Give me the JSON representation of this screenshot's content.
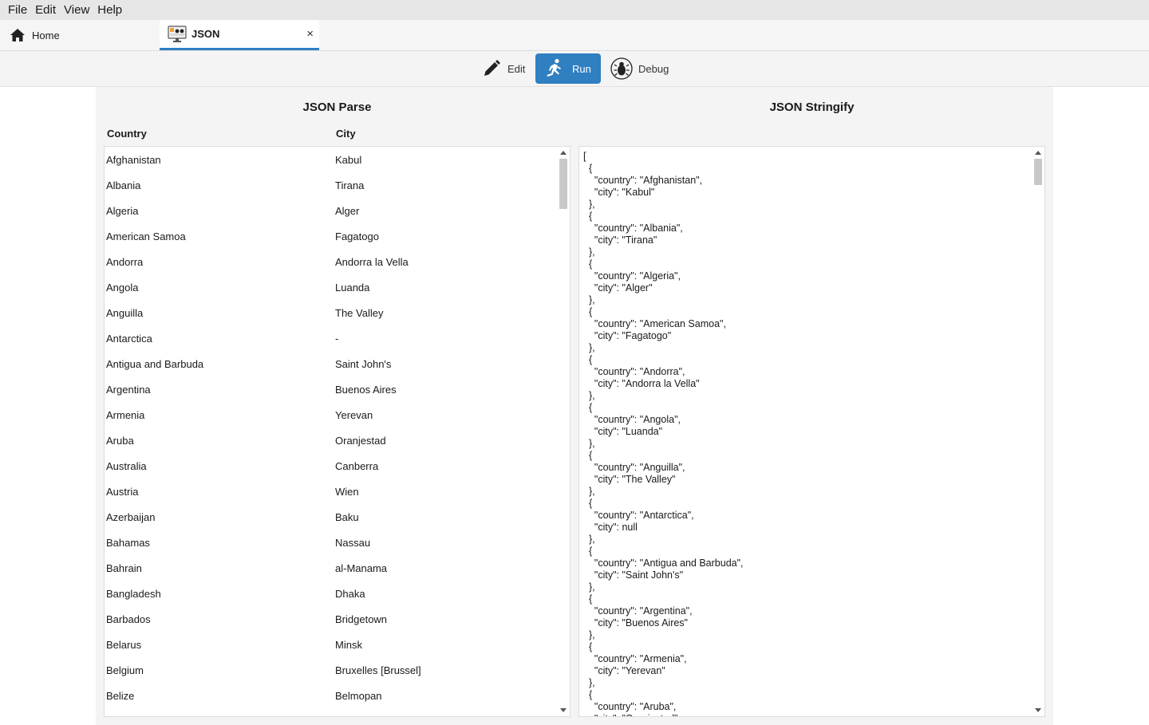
{
  "menu": [
    "File",
    "Edit",
    "View",
    "Help"
  ],
  "tabs": {
    "home_label": "Home",
    "json_label": "JSON",
    "close_glyph": "×"
  },
  "toolbar": {
    "edit_label": "Edit",
    "run_label": "Run",
    "debug_label": "Debug",
    "accent_color": "#2f7fc1"
  },
  "parse_panel": {
    "title": "JSON Parse",
    "col_country": "Country",
    "col_city": "City",
    "rows": [
      [
        "Afghanistan",
        "Kabul"
      ],
      [
        "Albania",
        "Tirana"
      ],
      [
        "Algeria",
        "Alger"
      ],
      [
        "American Samoa",
        "Fagatogo"
      ],
      [
        "Andorra",
        "Andorra la Vella"
      ],
      [
        "Angola",
        "Luanda"
      ],
      [
        "Anguilla",
        "The Valley"
      ],
      [
        "Antarctica",
        "-"
      ],
      [
        "Antigua and Barbuda",
        "Saint John's"
      ],
      [
        "Argentina",
        "Buenos Aires"
      ],
      [
        "Armenia",
        "Yerevan"
      ],
      [
        "Aruba",
        "Oranjestad"
      ],
      [
        "Australia",
        "Canberra"
      ],
      [
        "Austria",
        "Wien"
      ],
      [
        "Azerbaijan",
        "Baku"
      ],
      [
        "Bahamas",
        "Nassau"
      ],
      [
        "Bahrain",
        "al-Manama"
      ],
      [
        "Bangladesh",
        "Dhaka"
      ],
      [
        "Barbados",
        "Bridgetown"
      ],
      [
        "Belarus",
        "Minsk"
      ],
      [
        "Belgium",
        "Bruxelles [Brussel]"
      ],
      [
        "Belize",
        "Belmopan"
      ]
    ]
  },
  "stringify_panel": {
    "title": "JSON Stringify",
    "text": "[\n  {\n    \"country\": \"Afghanistan\",\n    \"city\": \"Kabul\"\n  },\n  {\n    \"country\": \"Albania\",\n    \"city\": \"Tirana\"\n  },\n  {\n    \"country\": \"Algeria\",\n    \"city\": \"Alger\"\n  },\n  {\n    \"country\": \"American Samoa\",\n    \"city\": \"Fagatogo\"\n  },\n  {\n    \"country\": \"Andorra\",\n    \"city\": \"Andorra la Vella\"\n  },\n  {\n    \"country\": \"Angola\",\n    \"city\": \"Luanda\"\n  },\n  {\n    \"country\": \"Anguilla\",\n    \"city\": \"The Valley\"\n  },\n  {\n    \"country\": \"Antarctica\",\n    \"city\": null\n  },\n  {\n    \"country\": \"Antigua and Barbuda\",\n    \"city\": \"Saint John's\"\n  },\n  {\n    \"country\": \"Argentina\",\n    \"city\": \"Buenos Aires\"\n  },\n  {\n    \"country\": \"Armenia\",\n    \"city\": \"Yerevan\"\n  },\n  {\n    \"country\": \"Aruba\",\n    \"city\": \"Oranjestad\""
  }
}
